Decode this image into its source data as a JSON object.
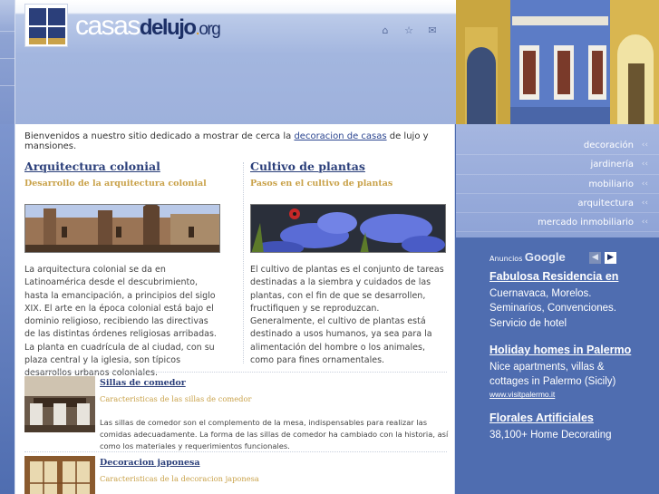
{
  "site": {
    "logo_main": "casas",
    "logo_de": "de",
    "logo_lujo": "lujo",
    "logo_dot": ".",
    "logo_org": "org"
  },
  "header_icons": [
    "home-icon",
    "star-icon",
    "mail-icon"
  ],
  "intro": {
    "before": "Bienvenidos a nuestro sitio dedicado a mostrar de cerca la ",
    "link": "decoracion de casas",
    "after": " de lujo y mansiones."
  },
  "articles": [
    {
      "title": "Arquitectura colonial",
      "subtitle": "Desarrollo de la arquitectura colonial",
      "body": "La arquitectura colonial se da en Latinoamérica desde el descubrimiento, hasta la emancipación, a principios del siglo XIX. El arte en la época colonial está bajo el dominio religioso, recibiendo las directivas de las distintas órdenes religiosas arribadas. La planta en cuadrícula de al ciudad, con su plaza central y la iglesia, son típicos desarrollos urbanos coloniales."
    },
    {
      "title": "Cultivo de plantas",
      "subtitle": "Pasos en el cultivo de plantas",
      "body": "El cultivo de plantas es el conjunto de tareas destinadas a la siembra y cuidados de las plantas, con el fin de que se desarrollen, fructifiquen y se reproduzcan. Generalmente, el cultivo de plantas está destinado a usos humanos, ya sea para la alimentación del hombre o los animales, como para fines ornamentales."
    }
  ],
  "small_items": [
    {
      "title": "Sillas de comedor",
      "subtitle": "Caracteristicas de las sillas de comedor",
      "body": "Las sillas de comedor son el complemento de la mesa, indispensables para realizar las comidas adecuadamente. La forma de las sillas de comedor ha cambiado con la historia, así como los materiales y requerimientos funcionales."
    },
    {
      "title": "Decoracion japonesa",
      "subtitle": "Caracteristicas de la decoracion japonesa",
      "body": ""
    }
  ],
  "nav": [
    {
      "label": "decoración",
      "arrow": "‹‹"
    },
    {
      "label": "jardinería",
      "arrow": "‹‹"
    },
    {
      "label": "mobiliario",
      "arrow": "‹‹"
    },
    {
      "label": "arquitectura",
      "arrow": "‹‹"
    },
    {
      "label": "mercado inmobiliario",
      "arrow": "‹‹"
    }
  ],
  "ads": {
    "label": "Anuncios",
    "brand": "Google",
    "prev": "◀",
    "next": "▶",
    "items": [
      {
        "title": "Fabulosa Residencia en",
        "text": "Cuernavaca, Morelos. Seminarios, Convenciones. Servicio de hotel",
        "url": ""
      },
      {
        "title": "Holiday homes in Palermo",
        "text": "Nice apartments, villas & cottages in Palermo (Sicily)",
        "url": "www.visitpalermo.it"
      },
      {
        "title": "Florales Artificiales",
        "text": "38,100+ Home Decorating",
        "url": ""
      }
    ]
  },
  "colors": {
    "accent_blue": "#2b3f7a",
    "gold": "#c9a24a",
    "sidebar_bg": "#4f6db0"
  }
}
